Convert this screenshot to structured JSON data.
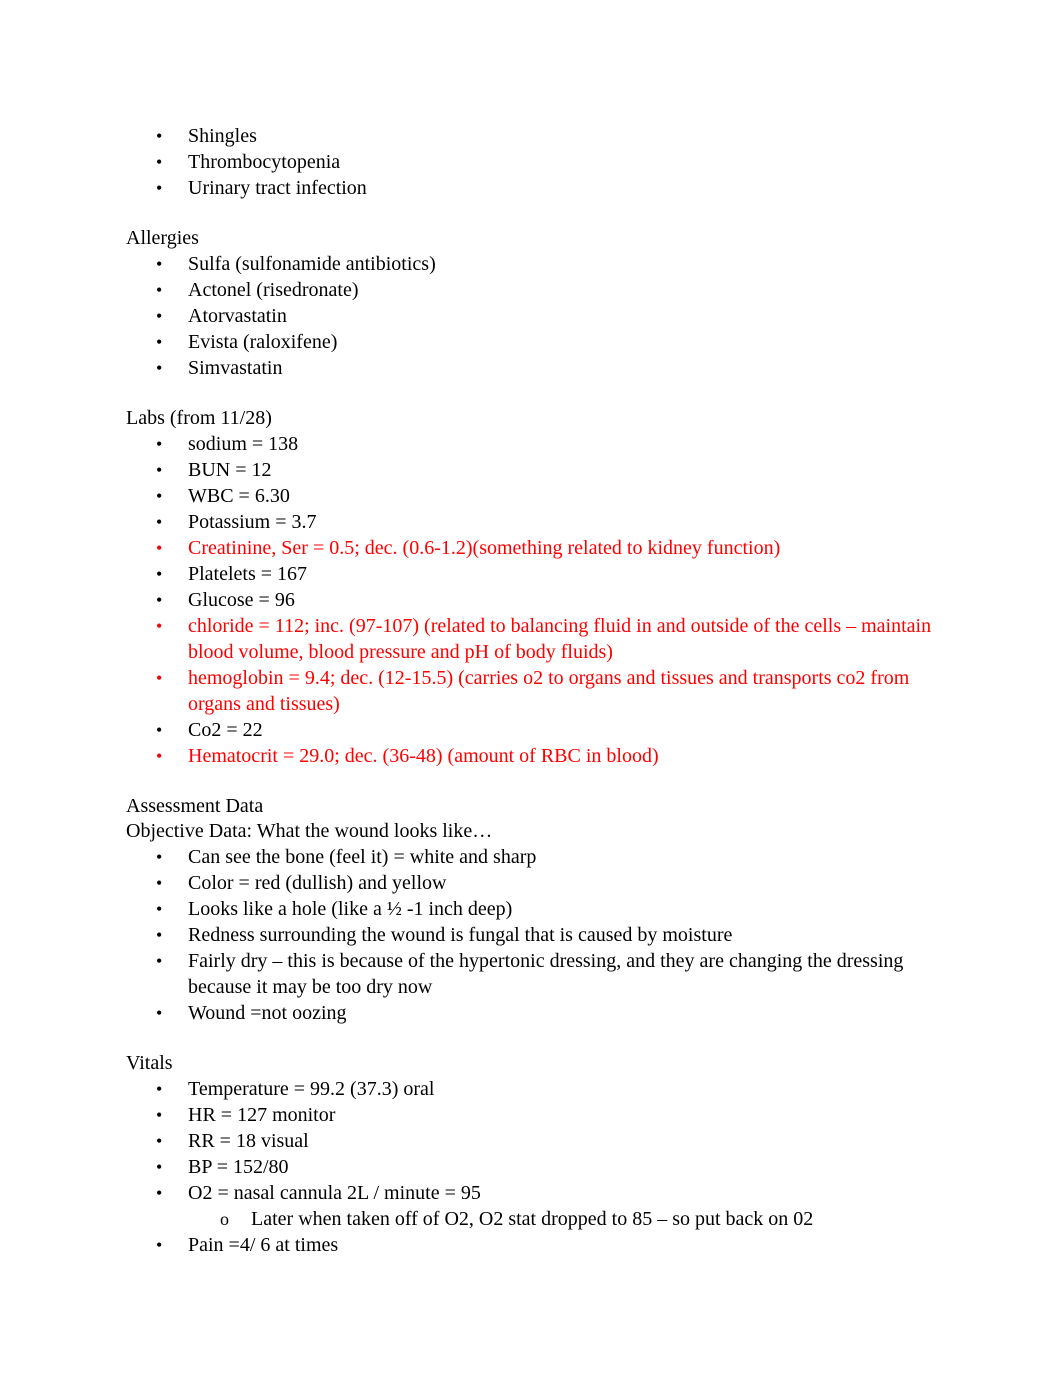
{
  "conditions": {
    "items": [
      {
        "text": "Shingles",
        "highlight": false
      },
      {
        "text": "Thrombocytopenia",
        "highlight": false
      },
      {
        "text": "Urinary tract infection",
        "highlight": false
      }
    ]
  },
  "allergies": {
    "heading": "Allergies",
    "items": [
      {
        "text": "Sulfa (sulfonamide antibiotics)",
        "highlight": false
      },
      {
        "text": "Actonel (risedronate)",
        "highlight": false
      },
      {
        "text": "Atorvastatin",
        "highlight": false
      },
      {
        "text": "Evista (raloxifene)",
        "highlight": false
      },
      {
        "text": "Simvastatin",
        "highlight": false
      }
    ]
  },
  "labs": {
    "heading": "Labs (from 11/28)",
    "items": [
      {
        "text": "sodium = 138",
        "highlight": false
      },
      {
        "text": "BUN = 12",
        "highlight": false
      },
      {
        "text": "WBC = 6.30",
        "highlight": false
      },
      {
        "text": "Potassium = 3.7",
        "highlight": false
      },
      {
        "text": "Creatinine, Ser = 0.5; dec. (0.6-1.2)(something related to kidney function)",
        "highlight": true
      },
      {
        "text": "Platelets = 167",
        "highlight": false
      },
      {
        "text": "Glucose = 96",
        "highlight": false
      },
      {
        "text": "chloride = 112; inc. (97-107) (related to balancing fluid in and outside of the cells – maintain blood volume, blood pressure and pH of body fluids)",
        "highlight": true
      },
      {
        "text": "hemoglobin = 9.4; dec. (12-15.5) (carries o2 to organs and tissues and transports co2 from organs and tissues)",
        "highlight": true
      },
      {
        "text": "Co2 = 22",
        "highlight": false
      },
      {
        "text": "Hematocrit = 29.0; dec. (36-48) (amount of RBC in blood)",
        "highlight": true
      }
    ]
  },
  "assessment": {
    "heading": "Assessment Data",
    "subheading": "Objective Data: What the wound looks like…",
    "items": [
      {
        "text": "Can see the bone (feel it) = white and sharp",
        "highlight": false
      },
      {
        "text": "Color = red (dullish) and yellow",
        "highlight": false
      },
      {
        "text": "Looks like a hole (like a ½ -1 inch deep)",
        "highlight": false
      },
      {
        "text": "Redness surrounding the wound is fungal that is caused by moisture",
        "highlight": false
      },
      {
        "text": "Fairly dry – this is because of the hypertonic dressing, and they are changing the dressing because it may be too dry now",
        "highlight": false
      },
      {
        "text": "Wound =not oozing",
        "highlight": false
      }
    ]
  },
  "vitals": {
    "heading": "Vitals",
    "items": [
      {
        "text": "Temperature = 99.2 (37.3) oral"
      },
      {
        "text": "HR = 127 monitor"
      },
      {
        "text": "RR = 18 visual"
      },
      {
        "text": "BP = 152/80"
      },
      {
        "text": "O2 = nasal cannula 2L / minute = 95"
      },
      {
        "text": "Later when taken off of O2, O2 stat dropped to 85 – so put back on 02",
        "sub": true
      },
      {
        "text": "Pain =4/ 6 at times"
      }
    ]
  },
  "style": {
    "bullet_glyph": "•",
    "sub_bullet_glyph": "o",
    "highlight_color": "#ff0000"
  }
}
